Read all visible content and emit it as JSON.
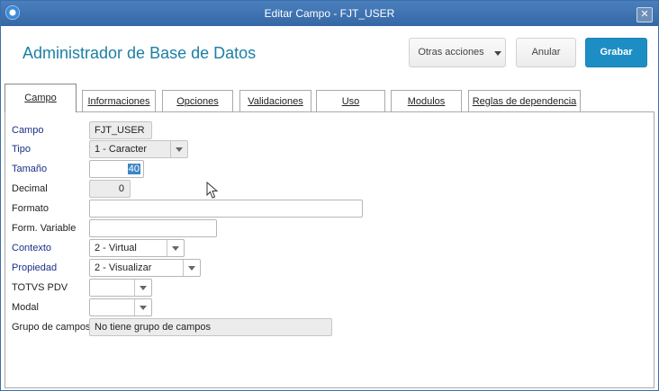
{
  "window": {
    "title": "Editar Campo - FJT_USER",
    "close_glyph": "✕"
  },
  "header": {
    "title": "Administrador de Base de Datos",
    "buttons": {
      "otras": "Otras acciones",
      "anular": "Anular",
      "grabar": "Grabar"
    }
  },
  "tabs": [
    {
      "label": "Campo",
      "active": true
    },
    {
      "label": "Informaciones"
    },
    {
      "label": "Opciones"
    },
    {
      "label": "Validaciones"
    },
    {
      "label": "Uso"
    },
    {
      "label": "Modulos"
    },
    {
      "label": "Reglas de dependencia"
    }
  ],
  "form": {
    "campo": {
      "label": "Campo",
      "value": "FJT_USER"
    },
    "tipo": {
      "label": "Tipo",
      "value": "1 - Caracter"
    },
    "tamano": {
      "label": "Tamaño",
      "value": "40"
    },
    "decimal": {
      "label": "Decimal",
      "value": "0"
    },
    "formato": {
      "label": "Formato",
      "value": ""
    },
    "form_variable": {
      "label": "Form. Variable",
      "value": ""
    },
    "contexto": {
      "label": "Contexto",
      "value": "2 - Virtual"
    },
    "propiedad": {
      "label": "Propiedad",
      "value": "2 - Visualizar"
    },
    "totvs_pdv": {
      "label": "TOTVS PDV",
      "value": ""
    },
    "modal": {
      "label": "Modal",
      "value": ""
    },
    "grupo_campos": {
      "label": "Grupo de campos",
      "value": "No tiene grupo de campos"
    }
  },
  "colors": {
    "title_bar": "#3567a5",
    "header_title": "#1b7fa5",
    "grabar_button": "#1d8ec4",
    "required_label": "#1a2f8a"
  }
}
